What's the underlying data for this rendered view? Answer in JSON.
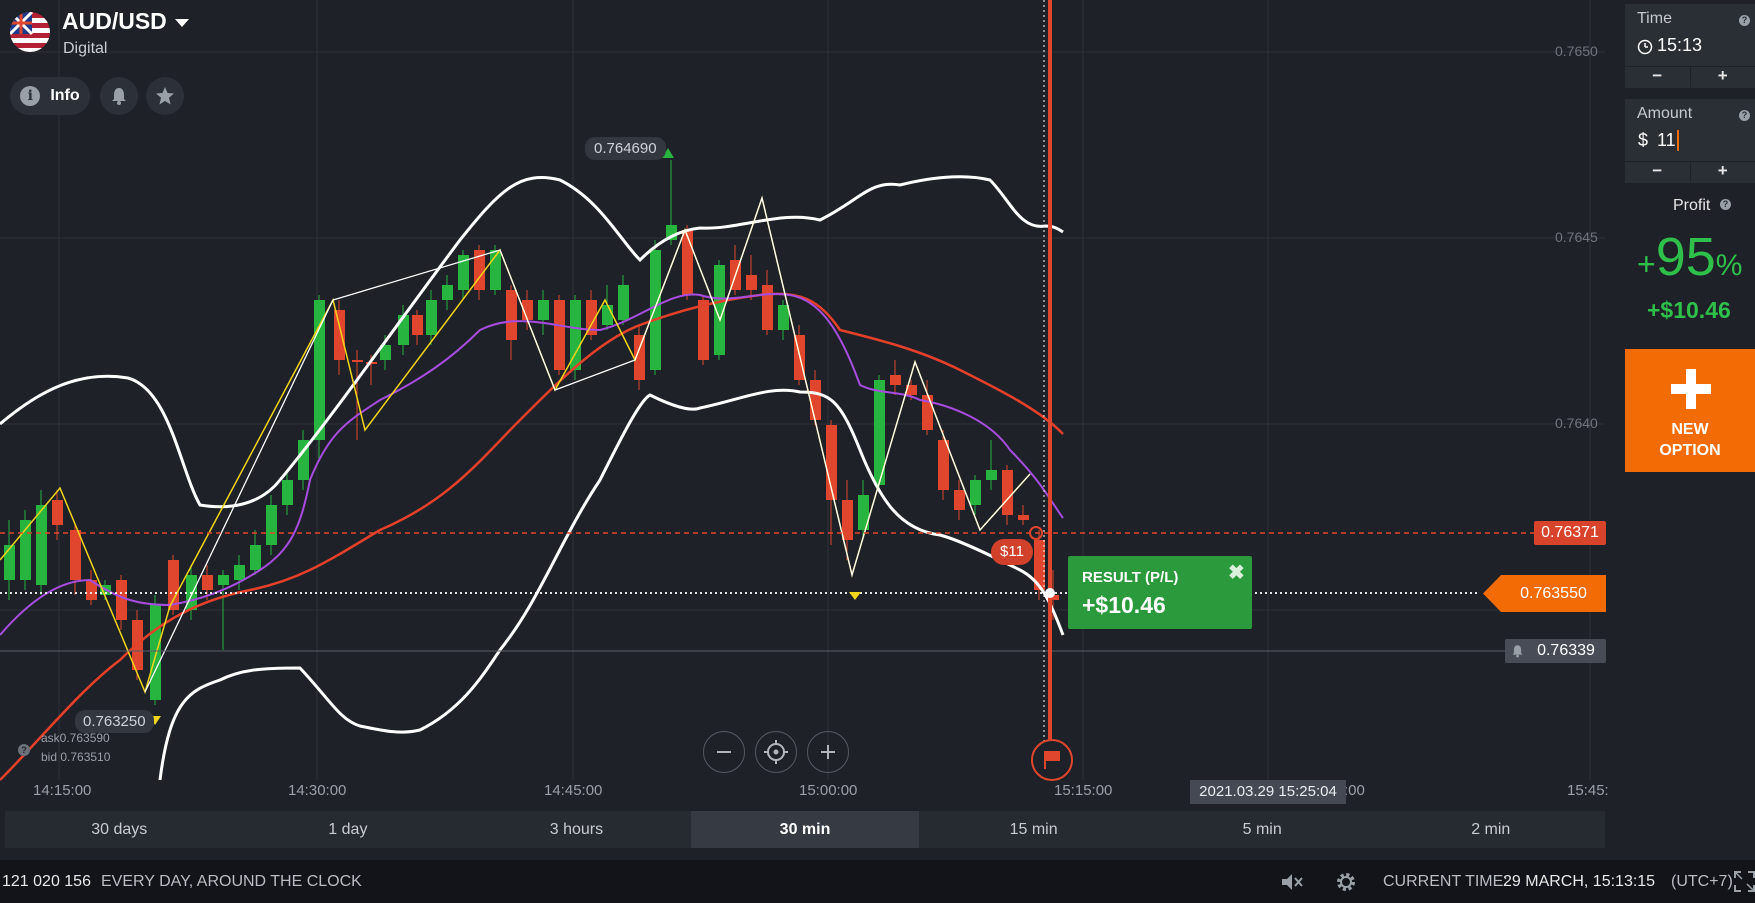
{
  "header": {
    "pair": "AUD/USD",
    "type": "Digital",
    "info_label": "Info"
  },
  "axis": {
    "prices": [
      "0.7650",
      "0.7645",
      "0.7640",
      "0.7635"
    ],
    "times": [
      "14:15:00",
      "14:30:00",
      "14:45:00",
      "15:00:00",
      "15:15:00",
      "15:45:"
    ],
    "time_partial": ":00"
  },
  "chart": {
    "max_label": "0.764690",
    "min_label": "0.763250",
    "ask": "ask0.763590",
    "bid": "bid 0.763510",
    "strike": "0.76371",
    "current": "0.763550",
    "alert": "0.76339",
    "bet_badge": "$11",
    "cursor_time": "2021.03.29 15:25:04"
  },
  "result": {
    "title": "RESULT (P/L)",
    "value": "+$10.46"
  },
  "panel": {
    "time_label": "Time",
    "time_value": "15:13",
    "amount_label": "Amount",
    "currency": "$",
    "amount_value": "11",
    "profit_label": "Profit",
    "profit_pct": "95",
    "profit_plus": "+",
    "profit_unit": "%",
    "profit_amount": "+$10.46",
    "new_option_l1": "NEW",
    "new_option_l2": "OPTION",
    "minus": "−",
    "plus": "+"
  },
  "timeframes": [
    "30 days",
    "1 day",
    "3 hours",
    "30 min",
    "15 min",
    "5 min",
    "2 min"
  ],
  "active_timeframe": "30 min",
  "footer": {
    "phone": "121 020 156",
    "slogan": "EVERY DAY, AROUND THE CLOCK",
    "current_time_label": "CURRENT TIME:",
    "current_time_value": "29 MARCH, 15:13:15",
    "timezone": "(UTC+7)"
  },
  "colors": {
    "up": "#27b43f",
    "down": "#e0462e",
    "bollinger": "#ffffff",
    "ma_slow": "#e5402a",
    "ma_fast": "#a64de0",
    "zigzag": "#f2d51b",
    "profit_green": "#2ec04a",
    "accent": "#f26b05"
  },
  "icons": [
    "info-icon",
    "bell-icon",
    "star-icon",
    "clock-icon",
    "zoom-out-icon",
    "center-icon",
    "zoom-in-icon",
    "flag-icon",
    "sound-off-icon",
    "gear-icon",
    "fullscreen-icon"
  ]
}
